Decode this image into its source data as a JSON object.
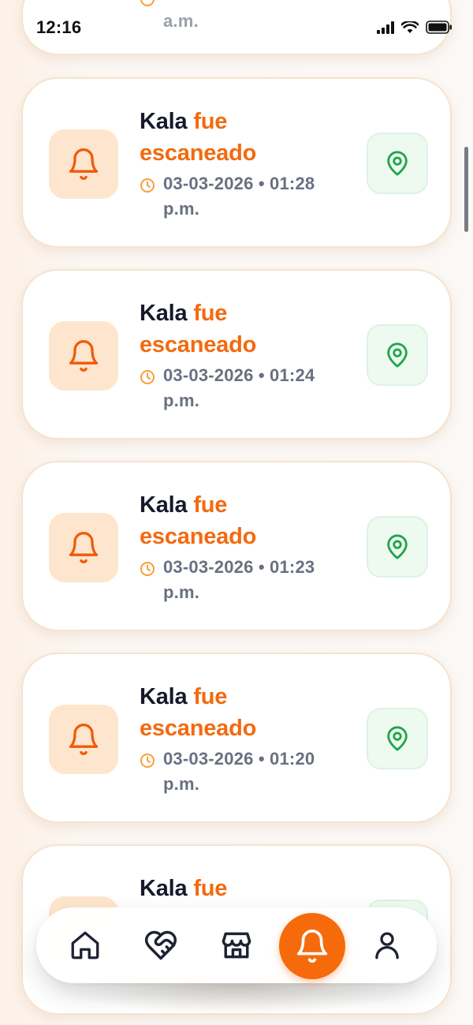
{
  "status_bar": {
    "time": "12:16"
  },
  "top_partial": {
    "time_fragment": "a.m."
  },
  "notifications": [
    {
      "pet": "Kala",
      "verb": "fue",
      "status": "escaneado",
      "date_time": "03-03-2026 • 01:28",
      "meridiem": "p.m."
    },
    {
      "pet": "Kala",
      "verb": "fue",
      "status": "escaneado",
      "date_time": "03-03-2026 • 01:24",
      "meridiem": "p.m."
    },
    {
      "pet": "Kala",
      "verb": "fue",
      "status": "escaneado",
      "date_time": "03-03-2026 • 01:23",
      "meridiem": "p.m."
    },
    {
      "pet": "Kala",
      "verb": "fue",
      "status": "escaneado",
      "date_time": "03-03-2026 • 01:20",
      "meridiem": "p.m."
    },
    {
      "pet": "Kala",
      "verb": "fue"
    }
  ],
  "colors": {
    "accent": "#f26a10",
    "title_dark": "#16192b",
    "muted": "#687080",
    "location_green": "#1fa64a",
    "icon_box": "#fde6cd"
  },
  "nav": {
    "items": [
      "home-icon",
      "heart-handshake-icon",
      "store-icon",
      "bell-icon",
      "user-icon"
    ],
    "active": "bell-icon"
  }
}
